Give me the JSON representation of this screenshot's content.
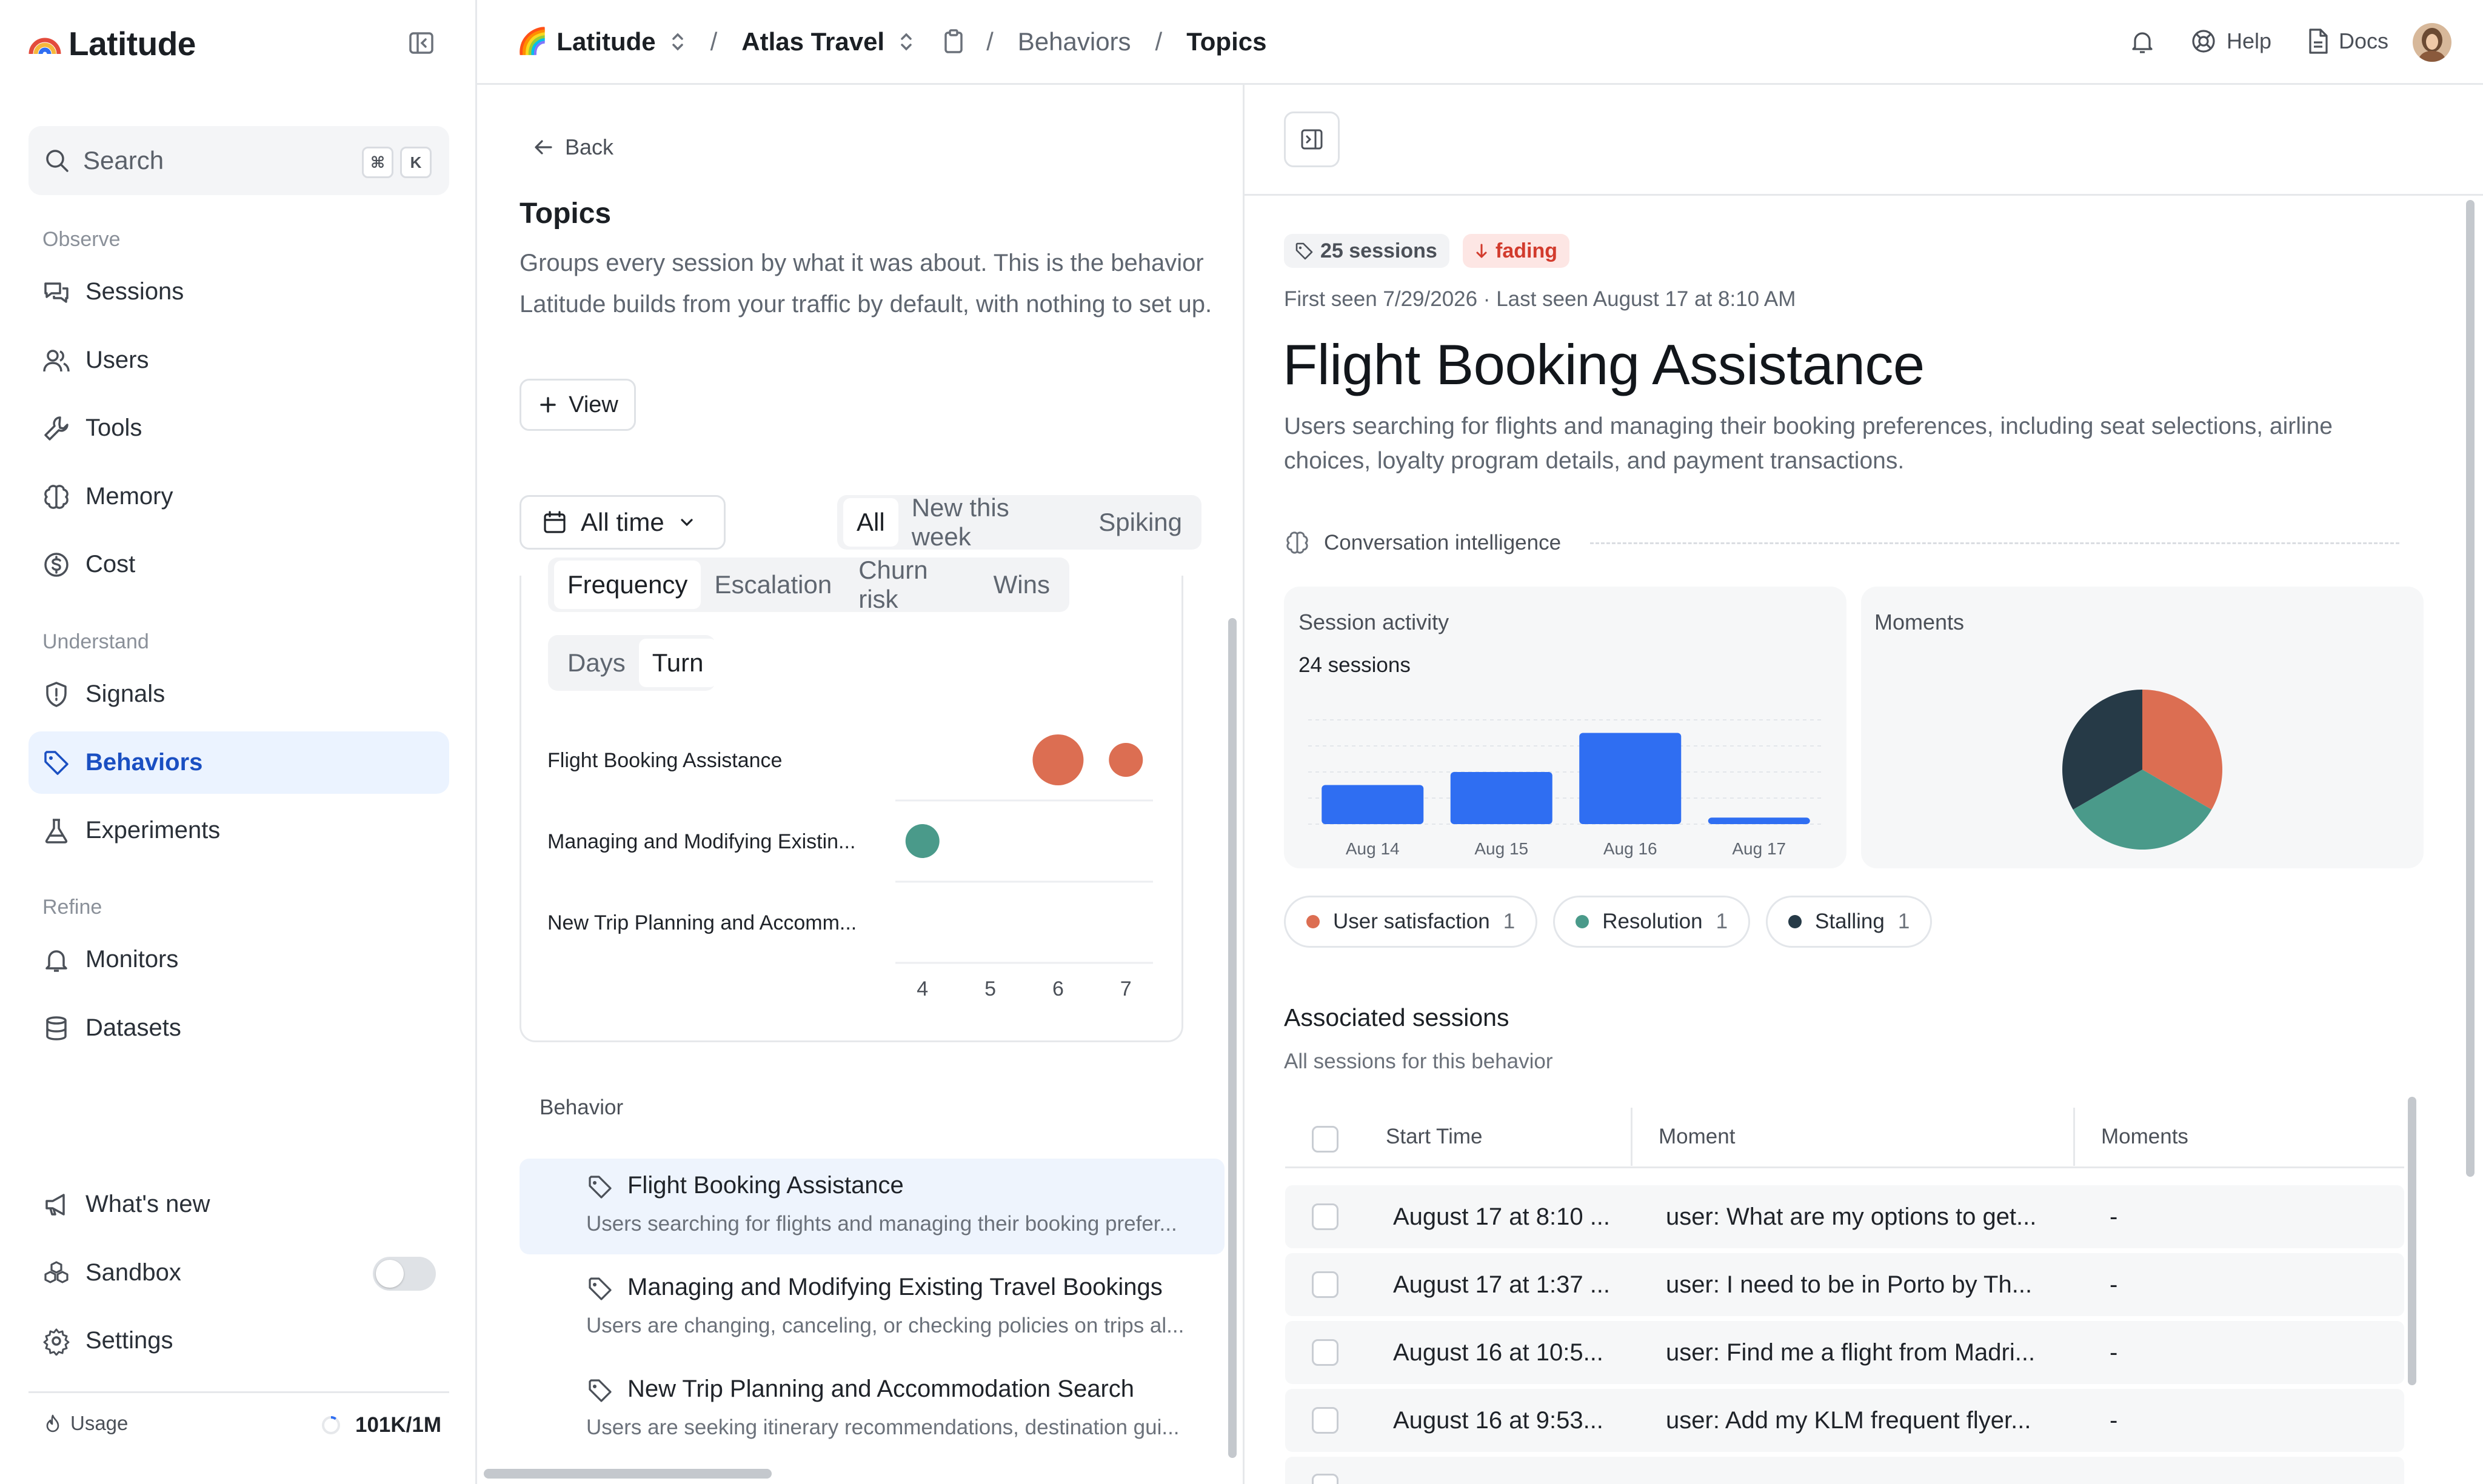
{
  "sidebar": {
    "logo": "Latitude",
    "search": {
      "label": "Search",
      "shortcut_mod": "⌘",
      "shortcut_key": "K"
    },
    "sections": {
      "observe": "Observe",
      "understand": "Understand",
      "refine": "Refine"
    },
    "items": {
      "sessions": "Sessions",
      "users": "Users",
      "tools": "Tools",
      "memory": "Memory",
      "cost": "Cost",
      "signals": "Signals",
      "behaviors": "Behaviors",
      "experiments": "Experiments",
      "monitors": "Monitors",
      "datasets": "Datasets",
      "whats_new": "What's new",
      "sandbox": "Sandbox",
      "settings": "Settings"
    },
    "sandbox_enabled": false,
    "usage": {
      "label": "Usage",
      "value": "101K/1M",
      "fraction": 0.101
    }
  },
  "topbar": {
    "project_emoji": "🌈",
    "project": "Latitude",
    "app": "Atlas Travel",
    "crumb_behaviors": "Behaviors",
    "crumb_topics": "Topics",
    "sep": "/",
    "help": "Help",
    "docs": "Docs"
  },
  "middle": {
    "back": "Back",
    "title": "Topics",
    "description": "Groups every session by what it was about. This is the behavior Latitude builds from your traffic by default, with nothing to set up.",
    "view_button": "View",
    "range": "All time",
    "filters": [
      "All",
      "New this week",
      "Spiking"
    ],
    "metric_tabs": [
      "Frequency",
      "Escalation",
      "Churn risk",
      "Wins"
    ],
    "unit_tabs": [
      "Days",
      "Turn"
    ],
    "behavior_header": "Behavior",
    "behaviors": [
      {
        "title": "Flight Booking Assistance",
        "sub": "Users searching for flights and managing their booking prefer..."
      },
      {
        "title": "Managing and Modifying Existing Travel Bookings",
        "sub": "Users are changing, canceling, or checking policies on trips al..."
      },
      {
        "title": "New Trip Planning and Accommodation Search",
        "sub": "Users are seeking itinerary recommendations, destination gui..."
      }
    ]
  },
  "chart_data": [
    {
      "type": "scatter",
      "title": "",
      "xlabel": "",
      "ylabel": "",
      "categories": [
        "Flight Booking Assistance",
        "Managing and Modifying Existin...",
        "New Trip Planning and Accomm..."
      ],
      "x_ticks": [
        4,
        5,
        6,
        7
      ],
      "xlim": [
        3.6,
        7.4
      ],
      "points": [
        {
          "category": "Flight Booking Assistance",
          "x": 6,
          "size": 2,
          "color": "#dc6e52"
        },
        {
          "category": "Flight Booking Assistance",
          "x": 7,
          "size": 1,
          "color": "#dc6e52"
        },
        {
          "category": "Managing and Modifying Existin...",
          "x": 4,
          "size": 1,
          "color": "#4a9a8a"
        }
      ]
    },
    {
      "type": "bar",
      "title": "Session activity",
      "subtitle": "24 sessions",
      "categories": [
        "Aug 14",
        "Aug 15",
        "Aug 16",
        "Aug 17"
      ],
      "values": [
        6,
        8,
        14,
        1
      ],
      "ylim": [
        0,
        16
      ],
      "color": "#2f6ef2",
      "grid": true
    },
    {
      "type": "pie",
      "title": "Moments",
      "slices": [
        {
          "label": "User satisfaction",
          "value": 1,
          "color": "#dc6e52"
        },
        {
          "label": "Resolution",
          "value": 1,
          "color": "#4a9a8a"
        },
        {
          "label": "Stalling",
          "value": 1,
          "color": "#263a47"
        }
      ]
    }
  ],
  "detail": {
    "sessions_badge": "25 sessions",
    "trend_badge": "fading",
    "meta": "First seen 7/29/2026 · Last seen August 17 at 8:10 AM",
    "title": "Flight Booking Assistance",
    "description": "Users searching for flights and managing their booking preferences, including seat selections, airline choices, loyalty program details, and payment transactions.",
    "intelligence_label": "Conversation intelligence",
    "legend": [
      {
        "label": "User satisfaction",
        "count": "1",
        "color": "#dc6e52"
      },
      {
        "label": "Resolution",
        "count": "1",
        "color": "#4a9a8a"
      },
      {
        "label": "Stalling",
        "count": "1",
        "color": "#263a47"
      }
    ],
    "associated_title": "Associated sessions",
    "associated_sub": "All sessions for this behavior",
    "table": {
      "headers": [
        "Start Time",
        "Moment",
        "Moments"
      ],
      "rows": [
        {
          "start": "August 17 at 8:10 ...",
          "moment": "user: What are my options to get...",
          "moments": "-"
        },
        {
          "start": "August 17 at 1:37 ...",
          "moment": "user: I need to be in Porto by Th...",
          "moments": "-"
        },
        {
          "start": "August 16 at 10:5...",
          "moment": "user: Find me a flight from Madri...",
          "moments": "-"
        },
        {
          "start": "August 16 at 9:53...",
          "moment": "user: Add my KLM frequent flyer...",
          "moments": "-"
        }
      ]
    }
  },
  "colors": {
    "accent": "#2f6ef2",
    "active_nav_bg": "#ebf3ff",
    "active_nav_text": "#1a4fc2",
    "fading_bg": "#fde6e4",
    "fading_text": "#d23b2d"
  }
}
